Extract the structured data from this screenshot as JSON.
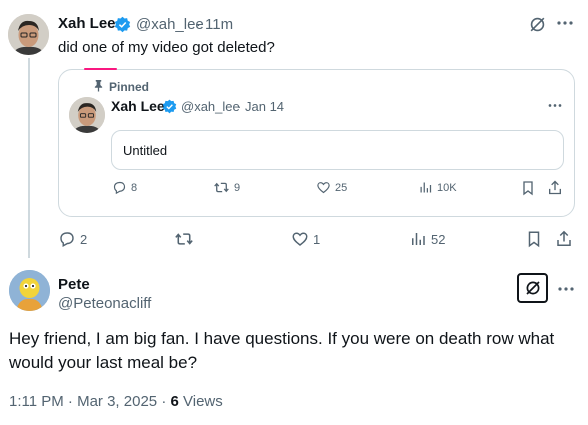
{
  "parent_tweet": {
    "author_name": "Xah Lee",
    "author_handle": "@xah_lee",
    "time_ago": "11m",
    "text": "did one of my video got deleted?",
    "actions": {
      "replies": "2",
      "retweets": "",
      "likes": "1",
      "views": "52"
    }
  },
  "quoted_tweet": {
    "pinned_label": "Pinned",
    "author_name": "Xah Lee",
    "author_handle": "@xah_lee",
    "date": "Jan 14",
    "media_title": "Untitled",
    "actions": {
      "replies": "8",
      "retweets": "9",
      "likes": "25",
      "views": "10K"
    }
  },
  "reply": {
    "author_name": "Pete",
    "author_handle": "@Peteonacliff",
    "text": "Hey friend, I am big fan. I have questions. If you were on death row what would your last meal be?",
    "time": "1:11 PM",
    "date": "Mar 3, 2025",
    "views_count": "6",
    "views_label": "Views"
  },
  "icons": {
    "verified": "verified-badge-icon",
    "grok": "grok-icon",
    "more": "more-icon",
    "pin": "pin-icon",
    "reply": "reply-icon",
    "retweet": "retweet-icon",
    "like": "heart-icon",
    "views": "views-icon",
    "bookmark": "bookmark-icon",
    "share": "share-icon"
  },
  "colors": {
    "verified_blue": "#1d9bf0",
    "text_primary": "#0f1419",
    "text_secondary": "#536471",
    "border": "#cfd9de",
    "pinned_accent": "#f91880"
  }
}
